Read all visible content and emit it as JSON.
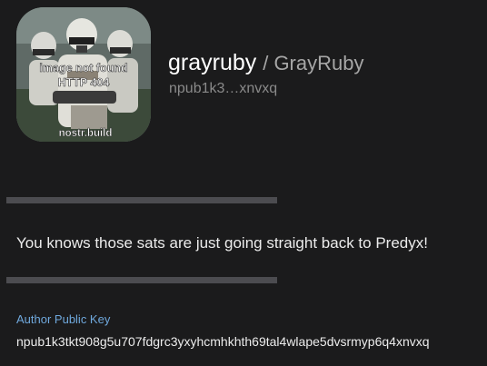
{
  "profile": {
    "name": "grayruby",
    "display_name": "/ GrayRuby",
    "npub_short": "npub1k3…xnvxq",
    "avatar": {
      "line1": "image not found",
      "line2": "HTTP 404",
      "watermark": "nostr.build"
    }
  },
  "note": {
    "content": "You knows those sats are just going straight back to Predyx!"
  },
  "author": {
    "label": "Author Public Key",
    "pubkey": "npub1k3tkt908g5u707fdgrc3yxyhcmhkhth69tal4wlape5dvsrmyp6q4xnvxq"
  },
  "colors": {
    "background": "#1b1b1c",
    "divider": "#4c4c50",
    "label_accent": "#6fa8dc",
    "text_primary": "#ececec",
    "text_muted": "#8a8a8a"
  }
}
